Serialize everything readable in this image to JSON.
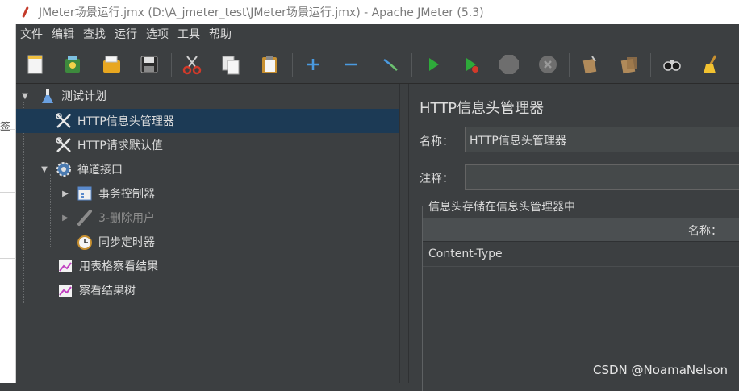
{
  "window": {
    "title": "JMeter场景运行.jmx (D:\\A_jmeter_test\\JMeter场景运行.jmx) - Apache JMeter (5.3)"
  },
  "left_edge_char": "签",
  "menu": [
    "文件",
    "编辑",
    "查找",
    "运行",
    "选项",
    "工具",
    "帮助"
  ],
  "toolbar_icons": [
    "new-icon",
    "templates-icon",
    "open-icon",
    "save-icon",
    "cut-icon",
    "copy-icon",
    "paste-icon",
    "expand-icon",
    "collapse-icon",
    "toggle-icon",
    "start-icon",
    "start-no-pause-icon",
    "stop-icon",
    "shutdown-icon",
    "clear-icon",
    "clear-all-icon",
    "search-icon",
    "reset-search-icon"
  ],
  "tree": {
    "nodes": [
      {
        "label": "测试计划",
        "icon": "test-plan-icon",
        "selected": false,
        "disabled": false
      },
      {
        "label": "HTTP信息头管理器",
        "icon": "tool-icon",
        "selected": true,
        "disabled": false
      },
      {
        "label": "HTTP请求默认值",
        "icon": "tool-icon",
        "selected": false,
        "disabled": false
      },
      {
        "label": "禅道接口",
        "icon": "gear-icon",
        "selected": false,
        "disabled": false
      },
      {
        "label": "事务控制器",
        "icon": "controller-icon",
        "selected": false,
        "disabled": false
      },
      {
        "label": "3-删除用户",
        "icon": "sampler-icon",
        "selected": false,
        "disabled": true
      },
      {
        "label": "同步定时器",
        "icon": "timer-icon",
        "selected": false,
        "disabled": false
      },
      {
        "label": "用表格察看结果",
        "icon": "chart-icon",
        "selected": false,
        "disabled": false
      },
      {
        "label": "察看结果树",
        "icon": "chart-icon",
        "selected": false,
        "disabled": false
      }
    ]
  },
  "panel": {
    "title": "HTTP信息头管理器",
    "name_label": "名称：",
    "name_value": "HTTP信息头管理器",
    "comment_label": "注释：",
    "comment_value": "",
    "group_title": "信息头存储在信息头管理器中",
    "table_header": "名称：",
    "rows": [
      "Content-Type"
    ]
  },
  "watermark": "CSDN @NoamaNelson",
  "colors": {
    "background": "#3c3f41",
    "selected": "#1c3a55",
    "text": "#dcdcdc",
    "start": "#2eaa3a"
  }
}
